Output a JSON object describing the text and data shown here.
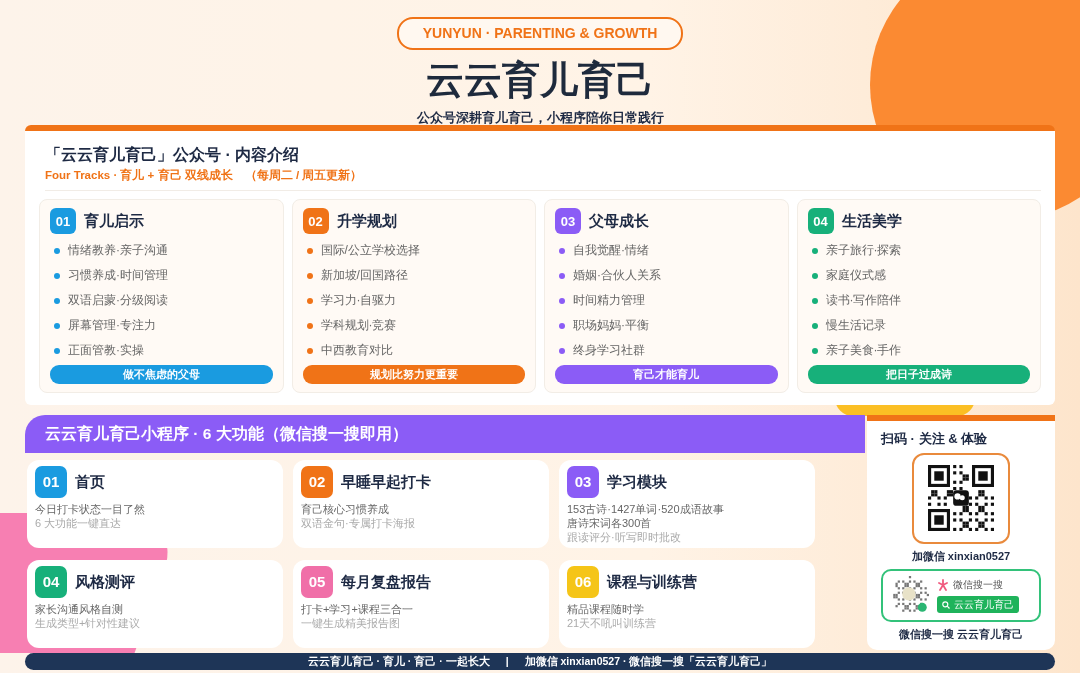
{
  "header": {
    "badge": "YUNYUN  ·  PARENTING & GROWTH",
    "title": "云云育儿育己",
    "subtitle": "公众号深耕育儿育己，小程序陪你日常践行"
  },
  "intro": {
    "heading": "「云云育儿育己」公众号 · 内容介绍",
    "subheading": "Four Tracks · 育儿 + 育己 双线成长　（每周二 / 周五更新）",
    "tracks": [
      {
        "num": "01",
        "title": "育儿启示",
        "color": "#1a9be0",
        "items": [
          "情绪教养·亲子沟通",
          "习惯养成·时间管理",
          "双语启蒙·分级阅读",
          "屏幕管理·专注力",
          "正面管教·实操"
        ],
        "tagline": "做不焦虑的父母"
      },
      {
        "num": "02",
        "title": "升学规划",
        "color": "#f07317",
        "items": [
          "国际/公立学校选择",
          "新加坡/回国路径",
          "学习力·自驱力",
          "学科规划·竞赛",
          "中西教育对比"
        ],
        "tagline": "规划比努力更重要"
      },
      {
        "num": "03",
        "title": "父母成长",
        "color": "#8b5cf6",
        "items": [
          "自我觉醒·情绪",
          "婚姻·合伙人关系",
          "时间精力管理",
          "职场妈妈·平衡",
          "终身学习社群"
        ],
        "tagline": "育己才能育儿"
      },
      {
        "num": "04",
        "title": "生活美学",
        "color": "#17b07a",
        "items": [
          "亲子旅行·探索",
          "家庭仪式感",
          "读书·写作陪伴",
          "慢生活记录",
          "亲子美食·手作"
        ],
        "tagline": "把日子过成诗"
      }
    ]
  },
  "miniprogram": {
    "banner": "云云育儿育己小程序 · 6 大功能（微信搜一搜即用）",
    "features": [
      {
        "num": "01",
        "title": "首页",
        "color": "#1a9be0",
        "lines": [
          {
            "kind": "main",
            "text": "今日打卡状态一目了然"
          },
          {
            "kind": "note",
            "text": "6 大功能一键直达"
          }
        ]
      },
      {
        "num": "02",
        "title": "早睡早起打卡",
        "color": "#f07317",
        "lines": [
          {
            "kind": "main",
            "text": "育己核心习惯养成"
          },
          {
            "kind": "note",
            "text": "双语金句·专属打卡海报"
          }
        ]
      },
      {
        "num": "03",
        "title": "学习模块",
        "color": "#8b5cf6",
        "lines": [
          {
            "kind": "main",
            "text": "153古诗·1427单词·520成语故事"
          },
          {
            "kind": "main",
            "text": "唐诗宋词各300首"
          },
          {
            "kind": "note",
            "text": "跟读评分·听写即时批改"
          }
        ]
      },
      {
        "num": "04",
        "title": "风格测评",
        "color": "#17b07a",
        "lines": [
          {
            "kind": "main",
            "text": "家长沟通风格自测"
          },
          {
            "kind": "note",
            "text": "生成类型+针对性建议"
          }
        ]
      },
      {
        "num": "05",
        "title": "每月复盘报告",
        "color": "#f06fa8",
        "lines": [
          {
            "kind": "main",
            "text": "打卡+学习+课程三合一"
          },
          {
            "kind": "note",
            "text": "一键生成精美报告图"
          }
        ]
      },
      {
        "num": "06",
        "title": "课程与训练营",
        "color": "#f5c518",
        "lines": [
          {
            "kind": "main",
            "text": "精品课程随时学"
          },
          {
            "kind": "note",
            "text": "21天不吼叫训练营"
          }
        ]
      }
    ]
  },
  "scan_panel": {
    "title": "扫码 · 关注 & 体验",
    "wechat_caption": "加微信  xinxian0527",
    "search_label": "微信搜一搜",
    "search_button": "云云育儿育己",
    "search_caption": "微信搜一搜  云云育儿育己"
  },
  "footer": [
    "云云育儿育己 · 育儿 · 育己 · 一起长大",
    "|",
    "加微信 xinxian0527 · 微信搜一搜「云云育儿育己」"
  ]
}
